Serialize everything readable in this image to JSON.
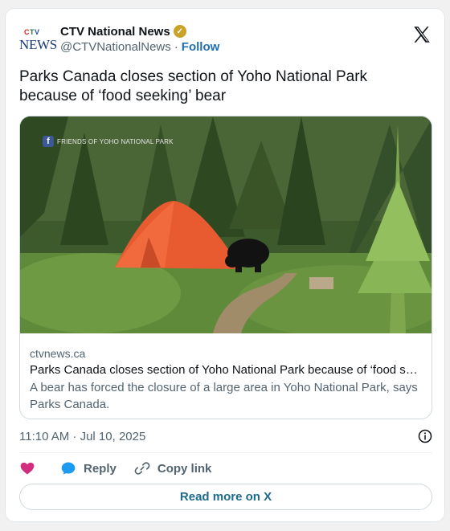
{
  "author": {
    "logo_ctv": "CTV",
    "logo_news": "NEWS",
    "name": "CTV National News",
    "handle": "@CTVNationalNews",
    "separator": "·",
    "follow_label": "Follow"
  },
  "tweet": {
    "text": "Parks Canada closes section of Yoho National Park because of ‘food seeking’ bear",
    "timestamp": "11:10 AM · Jul 10, 2025"
  },
  "link_card": {
    "photo_watermark": "FRIENDS OF YOHO NATIONAL PARK",
    "domain": "ctvnews.ca",
    "title": "Parks Canada closes section of Yoho National Park because of ‘food s…",
    "description": "A bear has forced the closure of a large area in Yoho National Park, says Parks Canada."
  },
  "actions": {
    "like_label": "",
    "reply_label": "Reply",
    "copy_link_label": "Copy link"
  },
  "read_more_label": "Read more on X",
  "colors": {
    "like": "#d12f7d",
    "reply": "#1d9bf0",
    "link": "#1d6fb8",
    "verified_gold": "#c9a227"
  },
  "icons": [
    "ctv-news-logo",
    "verified-badge-icon",
    "x-logo-icon",
    "facebook-icon",
    "info-icon",
    "heart-icon",
    "reply-bubble-icon",
    "link-icon"
  ]
}
